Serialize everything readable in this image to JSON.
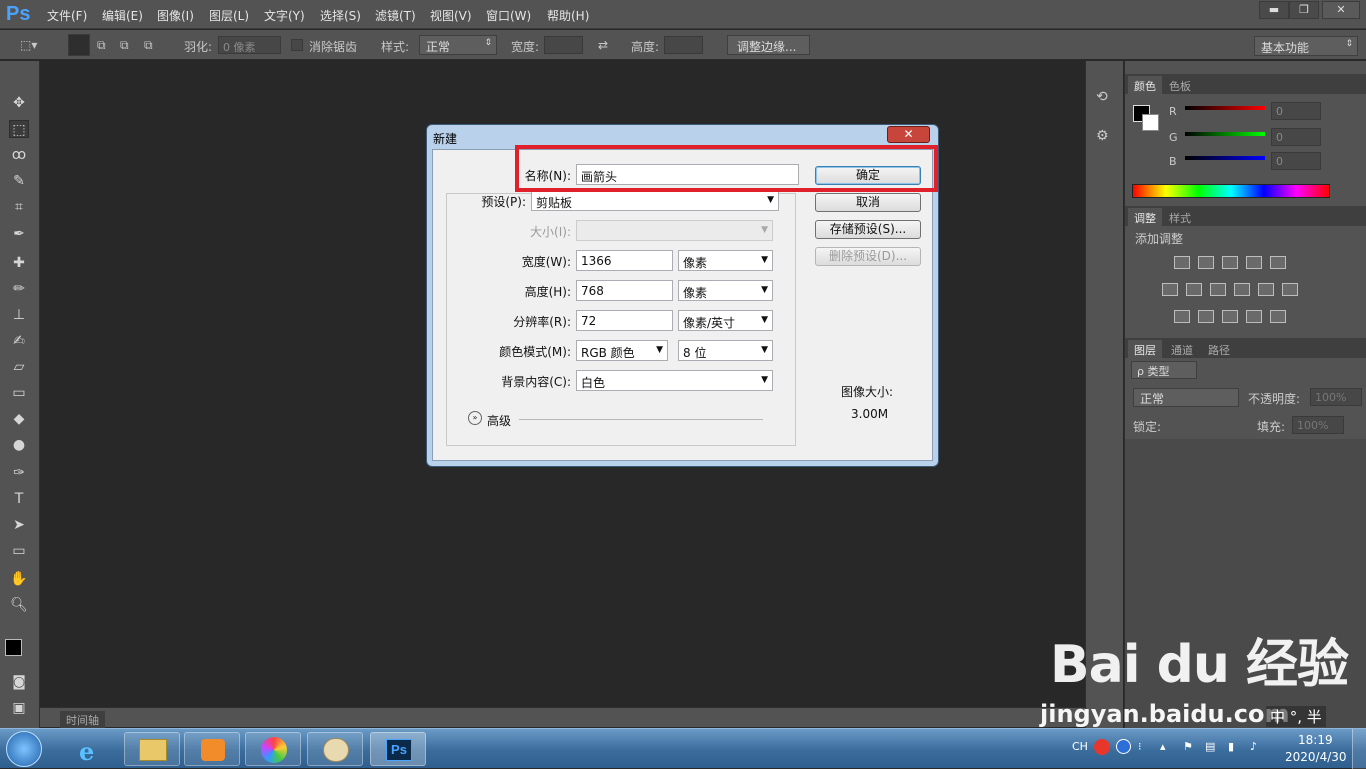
{
  "app": {
    "logo": "Ps"
  },
  "menus": [
    "文件(F)",
    "编辑(E)",
    "图像(I)",
    "图层(L)",
    "文字(Y)",
    "选择(S)",
    "滤镜(T)",
    "视图(V)",
    "窗口(W)",
    "帮助(H)"
  ],
  "window_controls": {
    "minimize": "▬",
    "restore": "❐",
    "close": "✕"
  },
  "options": {
    "feather_label": "羽化:",
    "feather_value": "0 像素",
    "antialias_label": "消除锯齿",
    "style_label": "样式:",
    "style_value": "正常",
    "width_label": "宽度:",
    "height_label": "高度:",
    "refine_edge": "调整边缘...",
    "workspace": "基本功能"
  },
  "panels": {
    "color_tabs": [
      "颜色",
      "色板"
    ],
    "channels": [
      "R",
      "G",
      "B"
    ],
    "channel_values": [
      "0",
      "0",
      "0"
    ],
    "adjust_tabs": [
      "调整",
      "样式"
    ],
    "add_adjustment": "添加调整",
    "layer_tabs": [
      "图层",
      "通道",
      "路径"
    ],
    "kind_label": "ρ 类型",
    "blend_mode": "正常",
    "opacity_label": "不透明度:",
    "opacity_value": "100%",
    "lock_label": "锁定:",
    "fill_label": "填充:",
    "fill_value": "100%"
  },
  "timeline_label": "时间轴",
  "dialog": {
    "title": "新建",
    "close": "✕",
    "name_label": "名称(N):",
    "name_value": "画箭头",
    "preset_label": "预设(P):",
    "preset_value": "剪贴板",
    "size_label": "大小(I):",
    "width_label": "宽度(W):",
    "width_value": "1366",
    "width_unit": "像素",
    "height_label": "高度(H):",
    "height_value": "768",
    "height_unit": "像素",
    "resolution_label": "分辨率(R):",
    "resolution_value": "72",
    "resolution_unit": "像素/英寸",
    "color_mode_label": "颜色模式(M):",
    "color_mode_value": "RGB 颜色",
    "bit_depth": "8 位",
    "background_label": "背景内容(C):",
    "background_value": "白色",
    "advanced": "高级",
    "ok": "确定",
    "cancel": "取消",
    "save_preset": "存储预设(S)...",
    "delete_preset": "删除预设(D)...",
    "image_size_label": "图像大小:",
    "image_size_value": "3.00M"
  },
  "taskbar": {
    "tray_lang": "CH",
    "time": "18:19",
    "date": "2020/4/30"
  },
  "watermark": {
    "logo": "Bai du 经验",
    "url": "jingyan.baidu.com"
  },
  "ime": "中 °, 半"
}
